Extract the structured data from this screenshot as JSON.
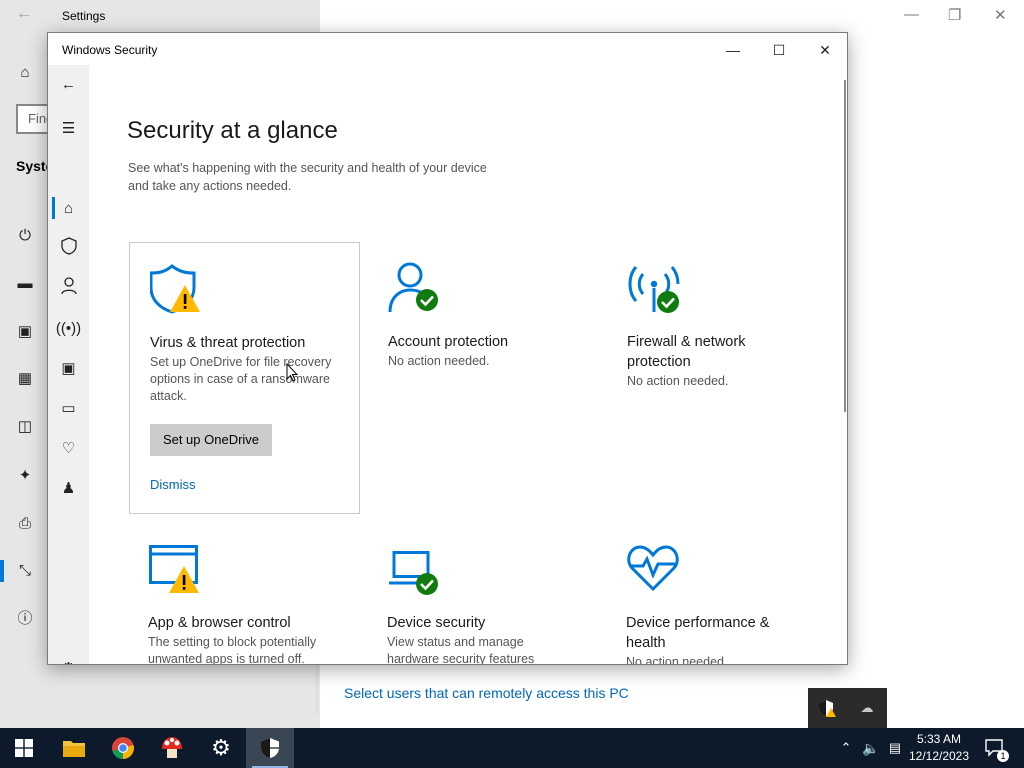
{
  "settings_window": {
    "title": "Settings",
    "search_placeholder": "Find",
    "section_label": "System",
    "link_text": "Select users that can remotely access this PC"
  },
  "security_window": {
    "title": "Windows Security",
    "page_title": "Security at a glance",
    "page_subtitle_line1": "See what's happening with the security and health of your device",
    "page_subtitle_line2": "and take any actions needed.",
    "cards": [
      {
        "title": "Virus & threat protection",
        "desc_line1": "Set up OneDrive for file recovery",
        "desc_line2": "options in case of a ransomware",
        "desc_line3": "attack.",
        "button": "Set up OneDrive",
        "link": "Dismiss",
        "status": "warning"
      },
      {
        "title": "Account protection",
        "desc": "No action needed.",
        "status": "ok"
      },
      {
        "title_line1": "Firewall & network",
        "title_line2": "protection",
        "desc": "No action needed.",
        "status": "ok"
      },
      {
        "title": "App & browser control",
        "desc_line1": "The setting to block potentially",
        "desc_line2": "unwanted apps is turned off.",
        "status": "warning"
      },
      {
        "title": "Device security",
        "desc_line1": "View status and manage",
        "desc_line2": "hardware security features",
        "status": "ok"
      },
      {
        "title_line1": "Device performance &",
        "title_line2": "health",
        "desc": "No action needed.",
        "status": "ok"
      }
    ]
  },
  "taskbar": {
    "time": "5:33 AM",
    "date": "12/12/2023",
    "notification_count": "1"
  },
  "colors": {
    "accent": "#0078d7",
    "link": "#0067b8",
    "ok": "#107c10",
    "warning": "#ffb900",
    "taskbar": "#0c1a2b"
  }
}
